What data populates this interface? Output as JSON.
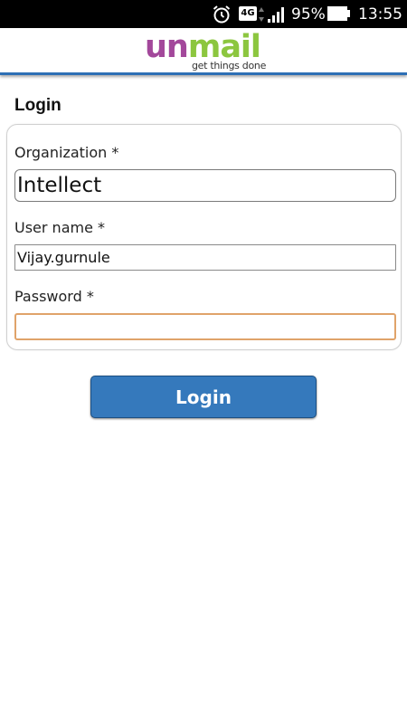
{
  "status_bar": {
    "network": "4G",
    "battery": "95%",
    "time": "13:55",
    "icons": [
      "alarm-icon",
      "signal-icon",
      "battery-icon"
    ]
  },
  "header": {
    "logo_part1": "un",
    "logo_part2": "mail",
    "tagline": "get things done"
  },
  "login": {
    "title": "Login",
    "organization_label": "Organization *",
    "organization_value": "Intellect",
    "username_label": "User name *",
    "username_value": "Vijay.gurnule",
    "password_label": "Password *",
    "password_value": "",
    "button_label": "Login"
  },
  "colors": {
    "header_border": "#2d6fb5",
    "button": "#3579bc",
    "logo_purple": "#a3489b",
    "logo_green": "#8cc63f",
    "focus_border": "#e0a36a"
  }
}
